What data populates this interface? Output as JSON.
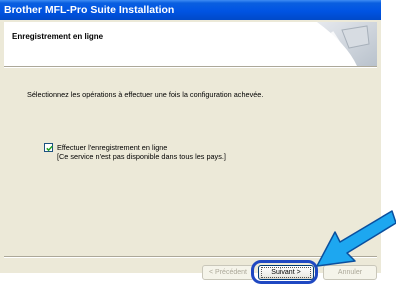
{
  "window": {
    "title": "Brother MFL-Pro Suite Installation"
  },
  "header": {
    "title": "Enregistrement en ligne"
  },
  "body": {
    "instruction": "Sélectionnez les opérations à effectuer une fois la configuration achevée.",
    "option": {
      "checked": true,
      "line1": "Effectuer l'enregistrement en ligne",
      "line2": "[Ce service n'est pas disponible dans tous les pays.]"
    }
  },
  "buttons": {
    "back": {
      "label": "< Précédent",
      "enabled": false
    },
    "next": {
      "label": "Suivant >",
      "enabled": true
    },
    "cancel": {
      "label": "Annuler",
      "enabled": false
    }
  },
  "colors": {
    "title_bar": "#0054e3",
    "highlight": "#1f48c2",
    "arrow": "#1da7f0"
  }
}
